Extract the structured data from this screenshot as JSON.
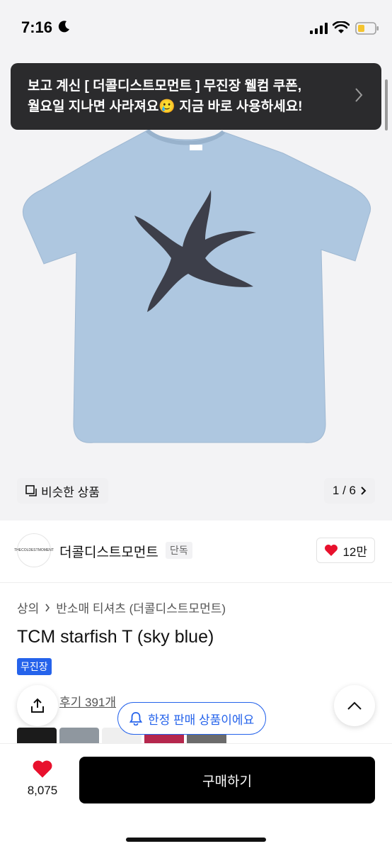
{
  "status_bar": {
    "time": "7:16"
  },
  "toast": {
    "line1": "보고 계신 [ 더콜디스트모먼트 ] 무진장 웰컴 쿠폰,",
    "line2": "월요일 지나면 사라져요🥲 지금 바로 사용하세요!"
  },
  "hero": {
    "similar_label": "비슷한 상품",
    "counter": "1 / 6",
    "image_index": 1,
    "image_total": 6
  },
  "brand": {
    "logo_text": "THECOLDESTMOMENT",
    "name": "더콜디스트모먼트",
    "exclusive_badge": "단독",
    "likes": "12만"
  },
  "breadcrumb": {
    "category": "상의",
    "subcategory": "반소매 티셔츠 (더콜디스트모먼트)"
  },
  "product": {
    "title": "TCM starfish T (sky blue)",
    "tag": "무진장",
    "reviews": "후기 391개"
  },
  "limited_label": "한정 판매 상품이에요",
  "bottom_bar": {
    "wish_count": "8,075",
    "buy_label": "구매하기"
  },
  "colors": {
    "accent_blue": "#2563eb",
    "heart_red": "#e8112d",
    "shirt": "#a9c4df",
    "starfish": "#3d3f4a"
  }
}
